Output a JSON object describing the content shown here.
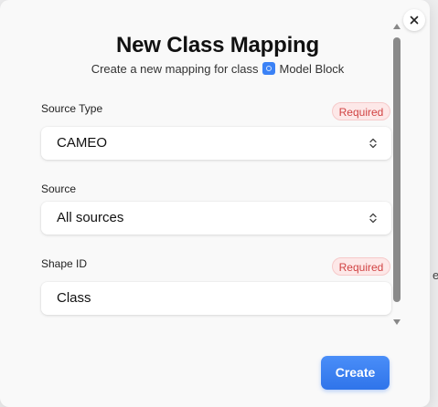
{
  "dialog": {
    "title": "New Class Mapping",
    "subtitle_prefix": "Create a new mapping for class",
    "class_name": "Model Block"
  },
  "fields": {
    "source_type": {
      "label": "Source Type",
      "required_label": "Required",
      "value": "CAMEO"
    },
    "source": {
      "label": "Source",
      "value": "All sources"
    },
    "shape_id": {
      "label": "Shape ID",
      "required_label": "Required",
      "value": "Class"
    }
  },
  "actions": {
    "create_label": "Create"
  },
  "background": {
    "right_fragment": "e"
  },
  "colors": {
    "accent": "#3b82f6",
    "required_text": "#d14343",
    "required_bg": "#fde8e8"
  },
  "icons": {
    "close": "close-icon",
    "class": "class-icon",
    "select": "chevron-up-down-icon"
  }
}
